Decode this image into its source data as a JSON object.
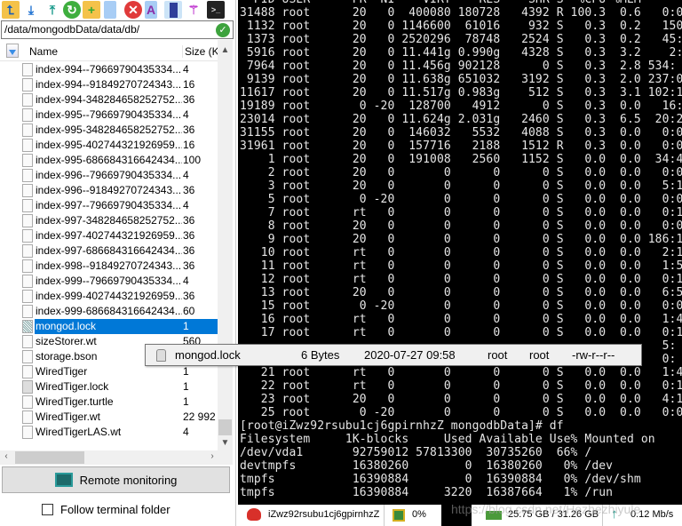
{
  "toolbar": {
    "icons": [
      "folder-up",
      "download",
      "upload",
      "refresh",
      "new-folder",
      "new-file",
      "delete",
      "text-editor",
      "open-panel",
      "magic-wand",
      "terminal"
    ]
  },
  "path": {
    "value": "/data/mongodbData/data/db/"
  },
  "list": {
    "header": {
      "name": "Name",
      "size": "Size (KB"
    },
    "rows": [
      {
        "name": "index-994--79669790435334...",
        "size": "4"
      },
      {
        "name": "index-994--91849270724343...",
        "size": "16"
      },
      {
        "name": "index-994-348284658252752...",
        "size": "36"
      },
      {
        "name": "index-995--79669790435334...",
        "size": "4"
      },
      {
        "name": "index-995-348284658252752...",
        "size": "36"
      },
      {
        "name": "index-995-402744321926959...",
        "size": "16"
      },
      {
        "name": "index-995-686684316642434...",
        "size": "100"
      },
      {
        "name": "index-996--79669790435334...",
        "size": "4"
      },
      {
        "name": "index-996--91849270724343...",
        "size": "36"
      },
      {
        "name": "index-997--79669790435334...",
        "size": "4"
      },
      {
        "name": "index-997-348284658252752...",
        "size": "36"
      },
      {
        "name": "index-997-402744321926959...",
        "size": "36"
      },
      {
        "name": "index-997-686684316642434...",
        "size": "36"
      },
      {
        "name": "index-998--91849270724343...",
        "size": "36"
      },
      {
        "name": "index-999--79669790435334...",
        "size": "4"
      },
      {
        "name": "index-999-402744321926959...",
        "size": "36"
      },
      {
        "name": "index-999-686684316642434...",
        "size": "60"
      },
      {
        "name": "mongod.lock",
        "size": "1",
        "selected": true,
        "icon": "hatch"
      },
      {
        "name": "sizeStorer.wt",
        "size": "560"
      },
      {
        "name": "storage.bson",
        "size": ""
      },
      {
        "name": "WiredTiger",
        "size": "1"
      },
      {
        "name": "WiredTiger.lock",
        "size": "1",
        "icon": "lock"
      },
      {
        "name": "WiredTiger.turtle",
        "size": "1"
      },
      {
        "name": "WiredTiger.wt",
        "size": "22 992"
      },
      {
        "name": "WiredTigerLAS.wt",
        "size": "4"
      }
    ]
  },
  "remote_button": "Remote monitoring",
  "follow_checkbox": {
    "label": "Follow terminal folder",
    "checked": false
  },
  "terminal": {
    "lines": [
      "  PID USER      PR  NI    VIRT    RES    SHR S  %CPU %MEM",
      "31488 root      20   0  400080 180728   4392 R 100.3  0.6   0:0",
      " 1132 root      20   0 1146600  61016    932 S   0.3  0.2   150",
      " 1373 root      20   0 2520296  78748   2524 S   0.3  0.2   45:",
      " 5916 root      20   0 11.441g 0.990g   4328 S   0.3  3.2    2:",
      " 7964 root      20   0 11.456g 902128      0 S   0.3  2.8 534:",
      " 9139 root      20   0 11.638g 651032   3192 S   0.3  2.0 237:0",
      "11617 root      20   0 11.517g 0.983g    512 S   0.3  3.1 102:1",
      "19189 root       0 -20  128700   4912      0 S   0.3  0.0   16:",
      "23014 root      20   0 11.624g 2.031g   2460 S   0.3  6.5  20:2",
      "31155 root      20   0  146032   5532   4088 S   0.3  0.0   0:0",
      "31961 root      20   0  157716   2188   1512 R   0.3  0.0   0:0",
      "    1 root      20   0  191008   2560   1152 S   0.0  0.0  34:4",
      "    2 root      20   0       0      0      0 S   0.0  0.0   0:0",
      "    3 root      20   0       0      0      0 S   0.0  0.0   5:1",
      "    5 root       0 -20       0      0      0 S   0.0  0.0   0:0",
      "    7 root      rt   0       0      0      0 S   0.0  0.0   0:1",
      "    8 root      20   0       0      0      0 S   0.0  0.0   0:0",
      "    9 root      20   0       0      0      0 S   0.0  0.0 186:1",
      "   10 root      rt   0       0      0      0 S   0.0  0.0   2:1",
      "   11 root      rt   0       0      0      0 S   0.0  0.0   1:5",
      "   12 root      rt   0       0      0      0 S   0.0  0.0   0:1",
      "   13 root      20   0       0      0      0 S   0.0  0.0   6:5",
      "   15 root       0 -20       0      0      0 S   0.0  0.0   0:0",
      "   16 root      rt   0       0      0      0 S   0.0  0.0   1:4",
      "   17 root      rt   0       0      0      0 S   0.0  0.0   0:1",
      "                                                            5:",
      "                                                            0:",
      "   21 root      rt   0       0      0      0 S   0.0  0.0   1:4",
      "   22 root      rt   0       0      0      0 S   0.0  0.0   0:1",
      "   23 root      20   0       0      0      0 S   0.0  0.0   4:1",
      "   25 root       0 -20       0      0      0 S   0.0  0.0   0:0",
      "[root@iZwz92rsubu1cj6gpirnhzZ mongodbData]# df",
      "Filesystem     1K-blocks     Used Available Use% Mounted on",
      "/dev/vda1       92759012 57813300  30735260  66% /",
      "devtmpfs        16380260        0  16380260   0% /dev",
      "tmpfs           16390884        0  16390884   0% /dev/shm",
      "tmpfs           16390884     3220  16387664   1% /run"
    ]
  },
  "tooltip": {
    "name": "mongod.lock",
    "size": "6 Bytes",
    "modified": "2020-07-27 09:58",
    "owner": "root",
    "group": "root",
    "permissions": "-rw-r--r--"
  },
  "status": {
    "host": "iZwz92rsubu1cj6gpirnhzZ",
    "cpu": "0%",
    "memory": "25.75 GB / 31.26 GB",
    "network": "0.12 Mb/s"
  },
  "watermark": "https://blog.csdn.net/Hezhezhiyule"
}
